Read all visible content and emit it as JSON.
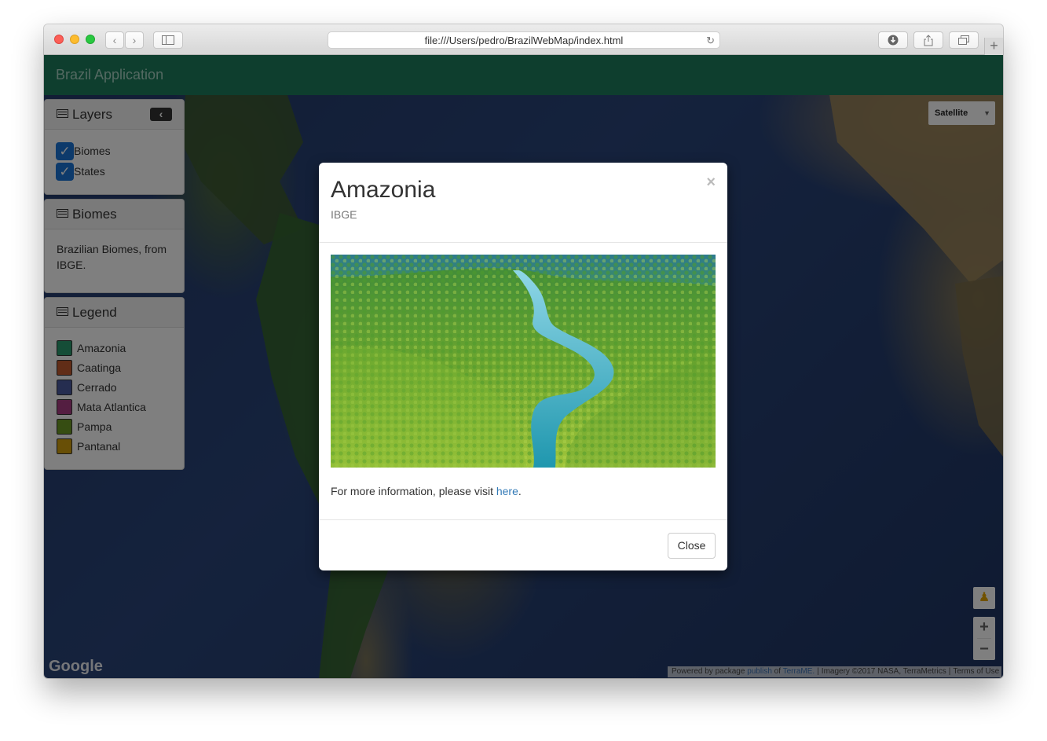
{
  "browser": {
    "url": "file:///Users/pedro/BrazilWebMap/index.html"
  },
  "app": {
    "brand": "Brazil Application"
  },
  "map": {
    "type_label": "Satellite",
    "google_logo": "Google",
    "attribution": {
      "powered_prefix": "Powered by package",
      "publish": "publish",
      "of": "of",
      "terrame": "TerraME.",
      "imagery": "Imagery ©2017 NASA, TerraMetrics",
      "terms": "Terms of Use"
    }
  },
  "layers_panel": {
    "title": "Layers",
    "items": [
      {
        "label": "Biomes",
        "checked": true
      },
      {
        "label": "States",
        "checked": true
      }
    ]
  },
  "biomes_panel": {
    "title": "Biomes",
    "text": "Brazilian Biomes, from IBGE."
  },
  "legend_panel": {
    "title": "Legend",
    "items": [
      {
        "label": "Amazonia",
        "color": "#2a9b6f"
      },
      {
        "label": "Caatinga",
        "color": "#c25a2f"
      },
      {
        "label": "Cerrado",
        "color": "#4a5aa0"
      },
      {
        "label": "Mata Atlantica",
        "color": "#a83d82"
      },
      {
        "label": "Pampa",
        "color": "#6c9b25"
      },
      {
        "label": "Pantanal",
        "color": "#d09f0d"
      }
    ]
  },
  "modal": {
    "title": "Amazonia",
    "subtitle": "IBGE",
    "text_prefix": "For more information, please visit",
    "link_text": "here",
    "text_suffix": ".",
    "close_label": "Close",
    "close_x": "×"
  }
}
